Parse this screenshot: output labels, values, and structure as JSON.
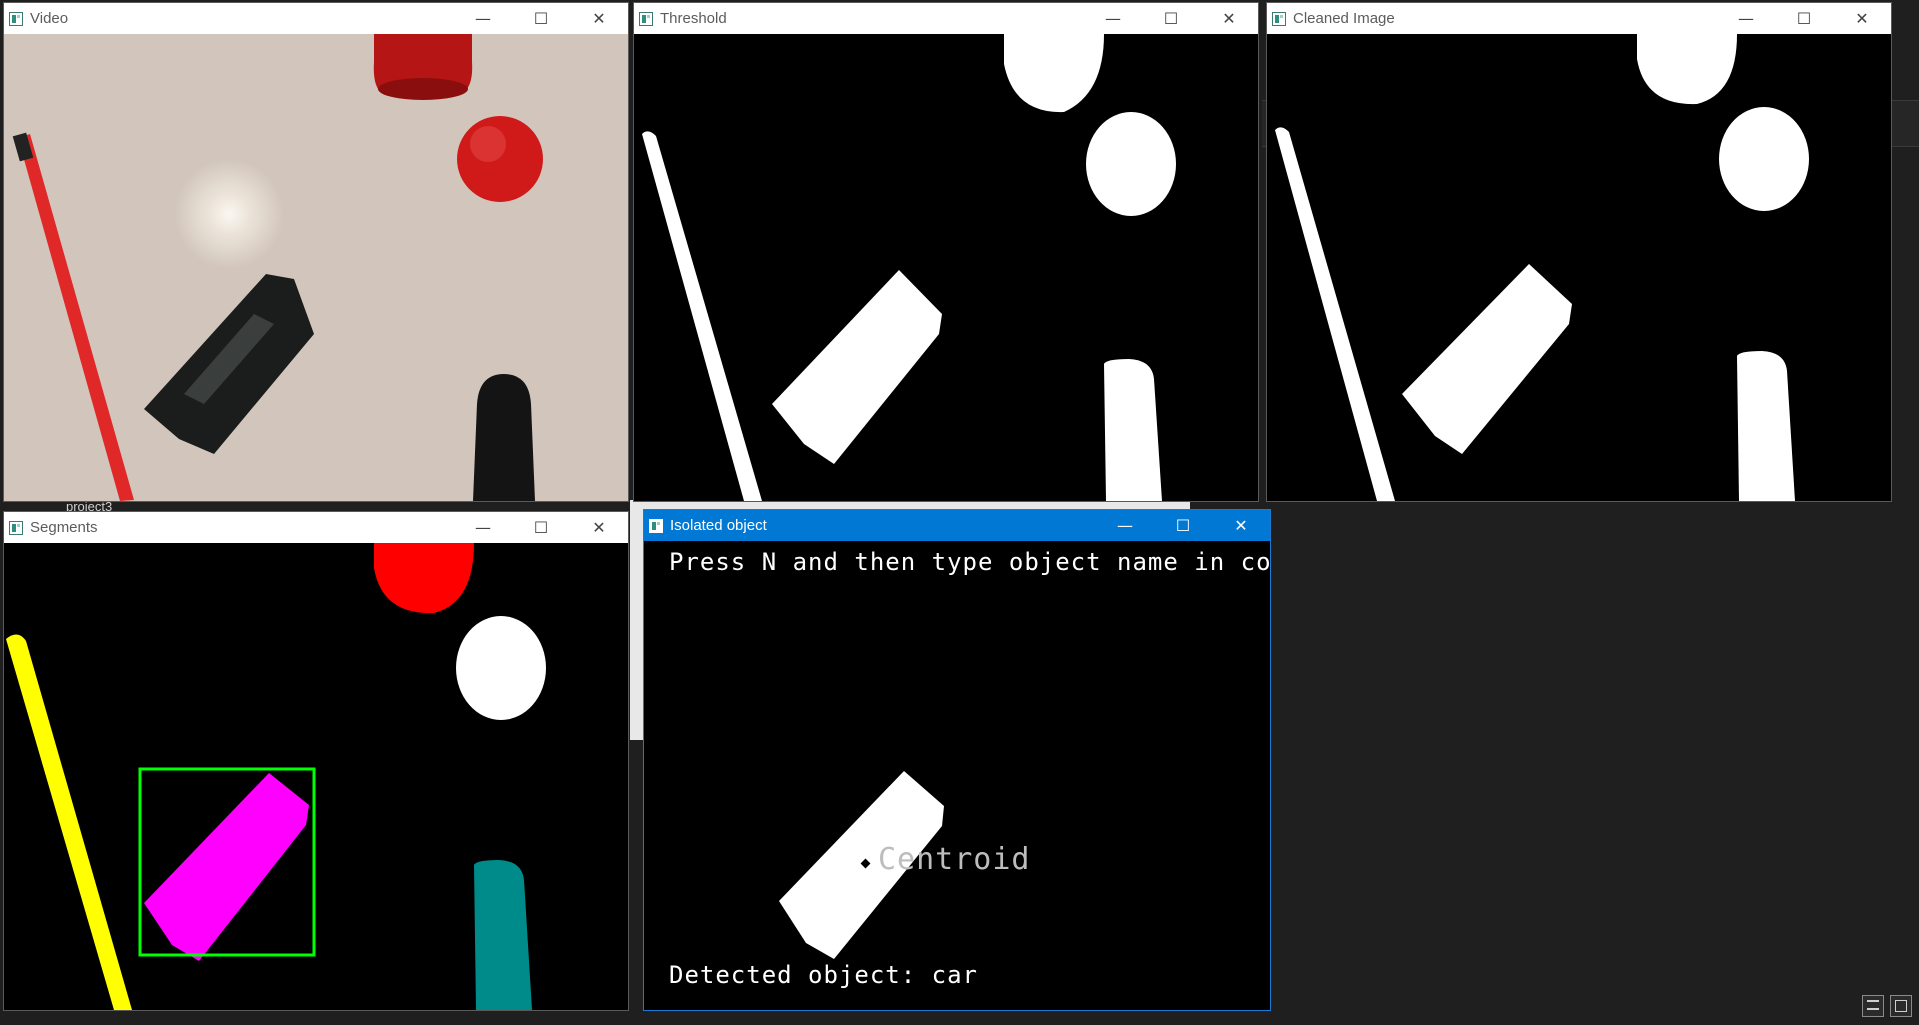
{
  "windows": {
    "video": {
      "title": "Video"
    },
    "threshold": {
      "title": "Threshold"
    },
    "cleaned": {
      "title": "Cleaned Image"
    },
    "segments": {
      "title": "Segments"
    },
    "isolated": {
      "title": "Isolated object",
      "instruction": "Press N and then type object name in console",
      "centroid_label": "Centroid",
      "detected_text": "Detected object: car"
    }
  },
  "controls": {
    "minimize": "—",
    "maximize": "☐",
    "close": "✕"
  },
  "background": {
    "folder_label": "project3"
  },
  "colors": {
    "active_title": "#0078d4",
    "segment_yellow": "#ffff00",
    "segment_red": "#ff0000",
    "segment_magenta": "#ff00ff",
    "segment_teal": "#008b8b",
    "bbox_green": "#00ff00"
  },
  "icons": [
    "opencv-window-icon",
    "minimize-icon",
    "maximize-icon",
    "close-icon",
    "view-list-icon",
    "view-window-icon"
  ]
}
